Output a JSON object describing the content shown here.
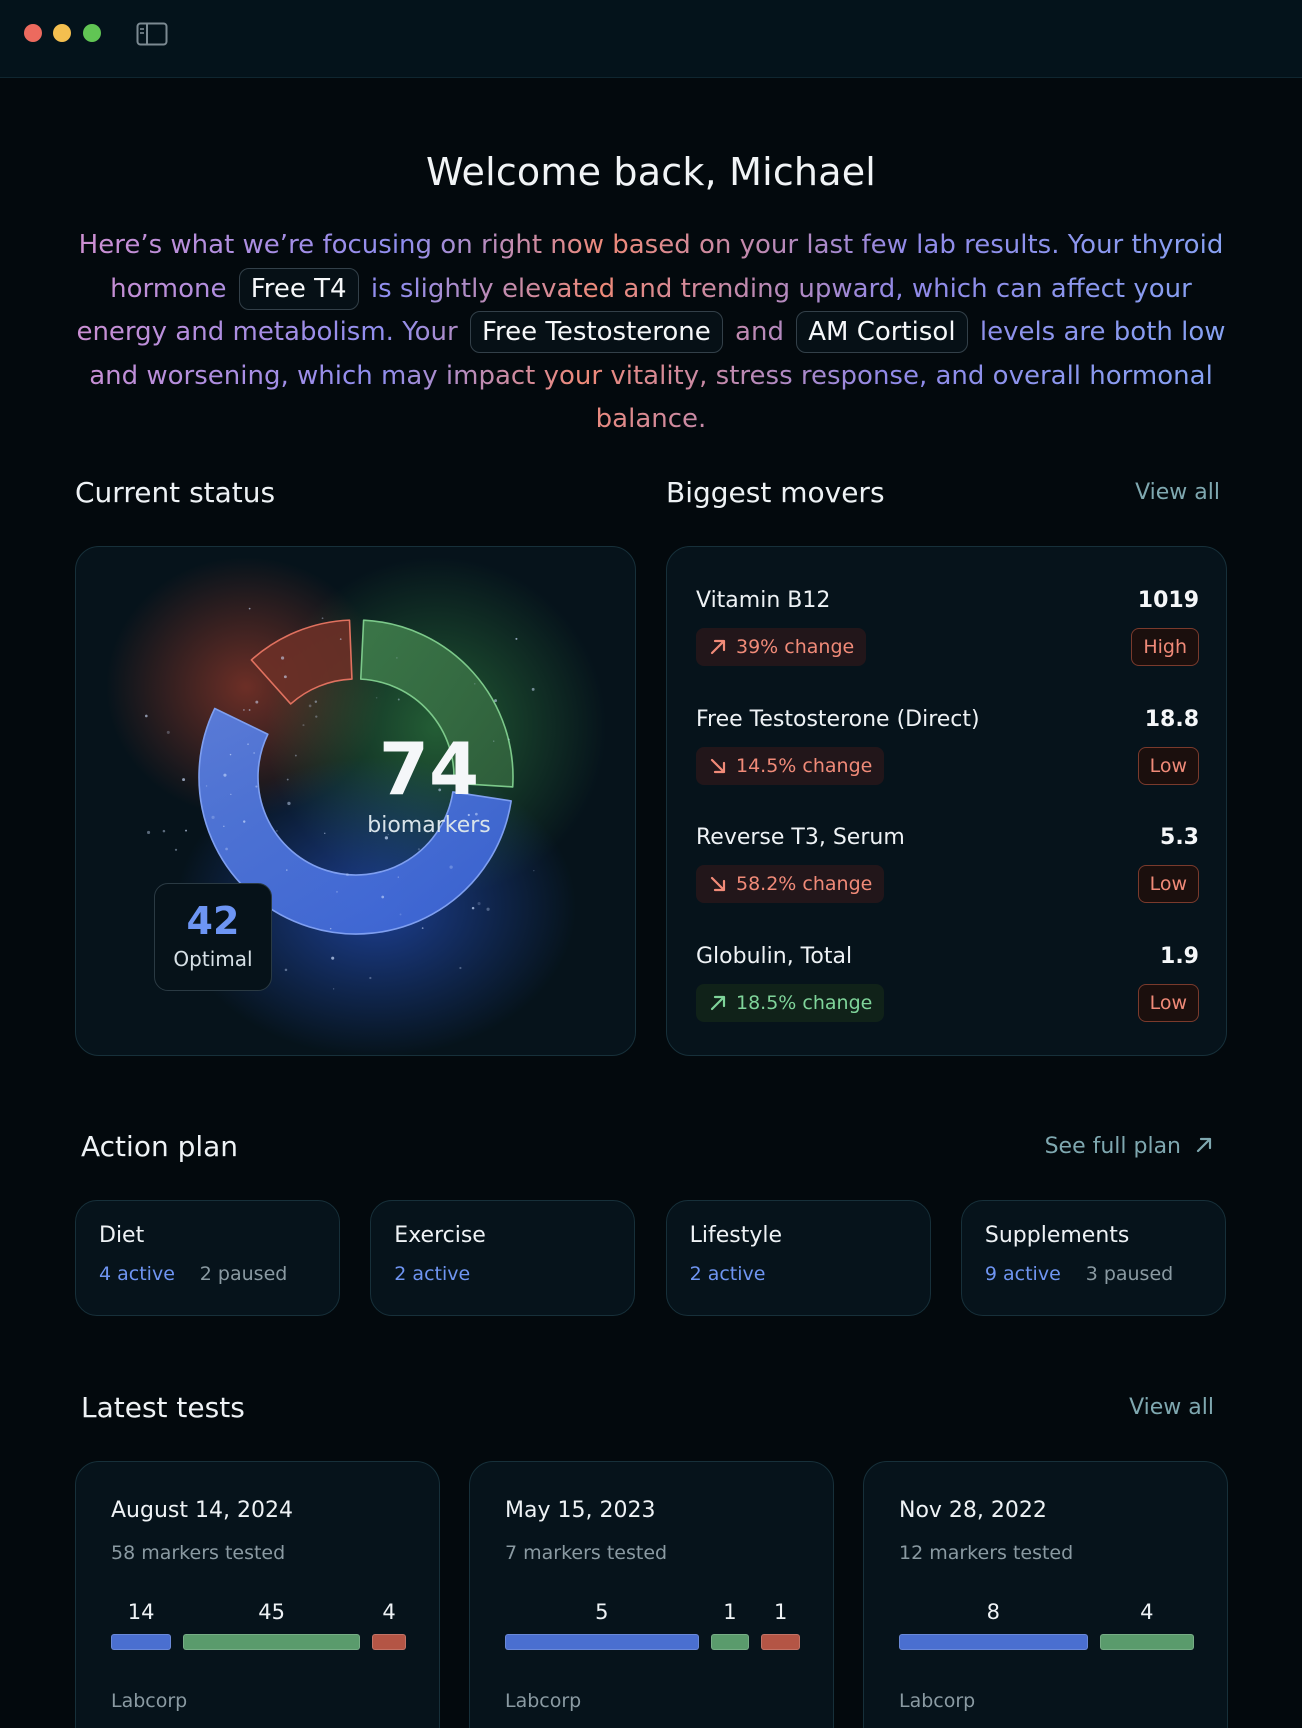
{
  "window": {
    "controls": [
      "close",
      "minimize",
      "maximize"
    ],
    "sidebar_toggle_icon": "sidebar-toggle-icon"
  },
  "welcome": {
    "title": "Welcome back, Michael",
    "intro_1": "Here’s what we’re focusing on right now based on your last few lab results. Your thyroid hormone",
    "chip_1": "Free T4",
    "intro_2": "is slightly elevated and trending upward, which can affect your energy and metabolism. Your",
    "chip_2": "Free Testosterone",
    "intro_3": "and",
    "chip_3": "AM Cortisol",
    "intro_4": "levels are both low and worsening, which may impact your vitality, stress response, and overall hormonal balance."
  },
  "current_status": {
    "title": "Current status",
    "total": "74",
    "total_label": "biomarkers",
    "optimal_count": "42",
    "optimal_label": "Optimal",
    "segments": [
      {
        "status": "out-of-range",
        "color": "#e0715f",
        "share": 0.13
      },
      {
        "status": "in-range",
        "color": "#5eb46e",
        "share": 0.28
      },
      {
        "status": "optimal",
        "color": "#4a79e0",
        "share": 0.59
      }
    ]
  },
  "movers": {
    "title": "Biggest movers",
    "view_all": "View all",
    "items": [
      {
        "name": "Vitamin B12",
        "value": "1019",
        "change": "39% change",
        "direction": "up",
        "trend_color": "red",
        "flag": "High"
      },
      {
        "name": "Free Testosterone (Direct)",
        "value": "18.8",
        "change": "14.5% change",
        "direction": "down",
        "trend_color": "red",
        "flag": "Low"
      },
      {
        "name": "Reverse T3, Serum",
        "value": "5.3",
        "change": "58.2% change",
        "direction": "down",
        "trend_color": "red",
        "flag": "Low"
      },
      {
        "name": "Globulin, Total",
        "value": "1.9",
        "change": "18.5% change",
        "direction": "up",
        "trend_color": "green",
        "flag": "Low"
      }
    ]
  },
  "action_plan": {
    "title": "Action plan",
    "see_full": "See full plan",
    "items": [
      {
        "name": "Diet",
        "active": "4 active",
        "paused": "2 paused"
      },
      {
        "name": "Exercise",
        "active": "2 active",
        "paused": ""
      },
      {
        "name": "Lifestyle",
        "active": "2 active",
        "paused": ""
      },
      {
        "name": "Supplements",
        "active": "9 active",
        "paused": "3 paused"
      }
    ]
  },
  "tests": {
    "title": "Latest tests",
    "view_all": "View all",
    "items": [
      {
        "date": "August 14, 2024",
        "markers": "58 markers tested",
        "lab": "Labcorp",
        "counts": [
          {
            "label": "14",
            "value": 14,
            "color": "#4a6fd0"
          },
          {
            "label": "45",
            "value": 45,
            "color": "#5a9b6c"
          },
          {
            "label": "4",
            "value": 4,
            "color": "#b45545"
          }
        ]
      },
      {
        "date": "May 15, 2023",
        "markers": "7 markers tested",
        "lab": "Labcorp",
        "counts": [
          {
            "label": "5",
            "value": 5,
            "color": "#4a6fd0"
          },
          {
            "label": "1",
            "value": 1,
            "color": "#5a9b6c"
          },
          {
            "label": "1",
            "value": 1,
            "color": "#b45545"
          }
        ]
      },
      {
        "date": "Nov 28, 2022",
        "markers": "12 markers tested",
        "lab": "Labcorp",
        "counts": [
          {
            "label": "8",
            "value": 8,
            "color": "#4a6fd0"
          },
          {
            "label": "4",
            "value": 4,
            "color": "#5a9b6c"
          }
        ]
      }
    ]
  }
}
